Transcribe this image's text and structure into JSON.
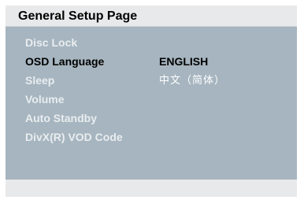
{
  "header": {
    "title": "General Setup Page"
  },
  "menu": {
    "items": [
      {
        "label": "Disc Lock",
        "selected": false
      },
      {
        "label": "OSD Language",
        "selected": true
      },
      {
        "label": "Sleep",
        "selected": false
      },
      {
        "label": "Volume",
        "selected": false
      },
      {
        "label": "Auto Standby",
        "selected": false
      },
      {
        "label": "DivX(R) VOD Code",
        "selected": false
      }
    ]
  },
  "submenu": {
    "options": [
      {
        "label": "ENGLISH",
        "selected": true
      },
      {
        "label": "中文（简体）",
        "selected": false
      }
    ]
  },
  "colors": {
    "panel_background": "#a6b5bf",
    "header_background": "#e8e9ea",
    "item_text": "#e9edf0",
    "selected_text": "#000000"
  }
}
